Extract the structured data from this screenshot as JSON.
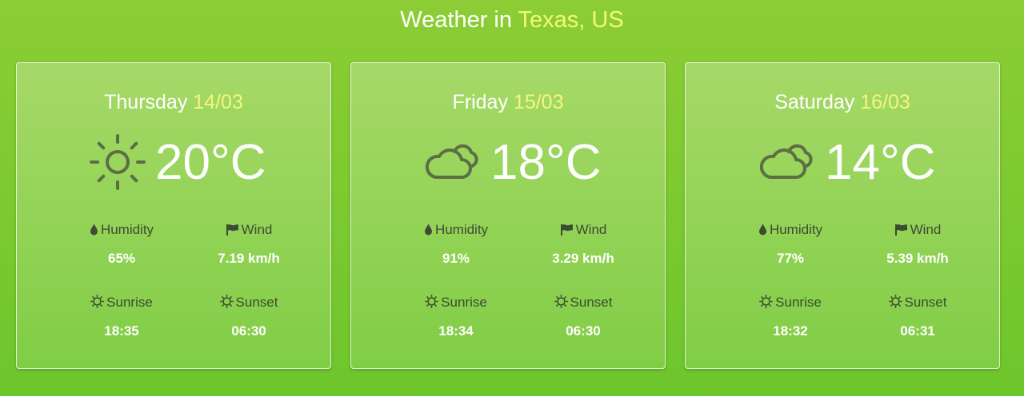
{
  "header": {
    "prefix": "Weather in",
    "location": "Texas, US"
  },
  "colors": {
    "accent": "#f4f77c",
    "icon": "#5b6e45",
    "label": "#3d4a34"
  },
  "labels": {
    "humidity": "Humidity",
    "wind": "Wind",
    "sunrise": "Sunrise",
    "sunset": "Sunset"
  },
  "days": [
    {
      "day": "Thursday",
      "date": "14/03",
      "icon": "sun-icon",
      "temp": "20°C",
      "humidity": "65%",
      "wind": "7.19 km/h",
      "sunrise": "18:35",
      "sunset": "06:30"
    },
    {
      "day": "Friday",
      "date": "15/03",
      "icon": "cloud-icon",
      "temp": "18°C",
      "humidity": "91%",
      "wind": "3.29 km/h",
      "sunrise": "18:34",
      "sunset": "06:30"
    },
    {
      "day": "Saturday",
      "date": "16/03",
      "icon": "cloud-icon",
      "temp": "14°C",
      "humidity": "77%",
      "wind": "5.39 km/h",
      "sunrise": "18:32",
      "sunset": "06:31"
    }
  ]
}
